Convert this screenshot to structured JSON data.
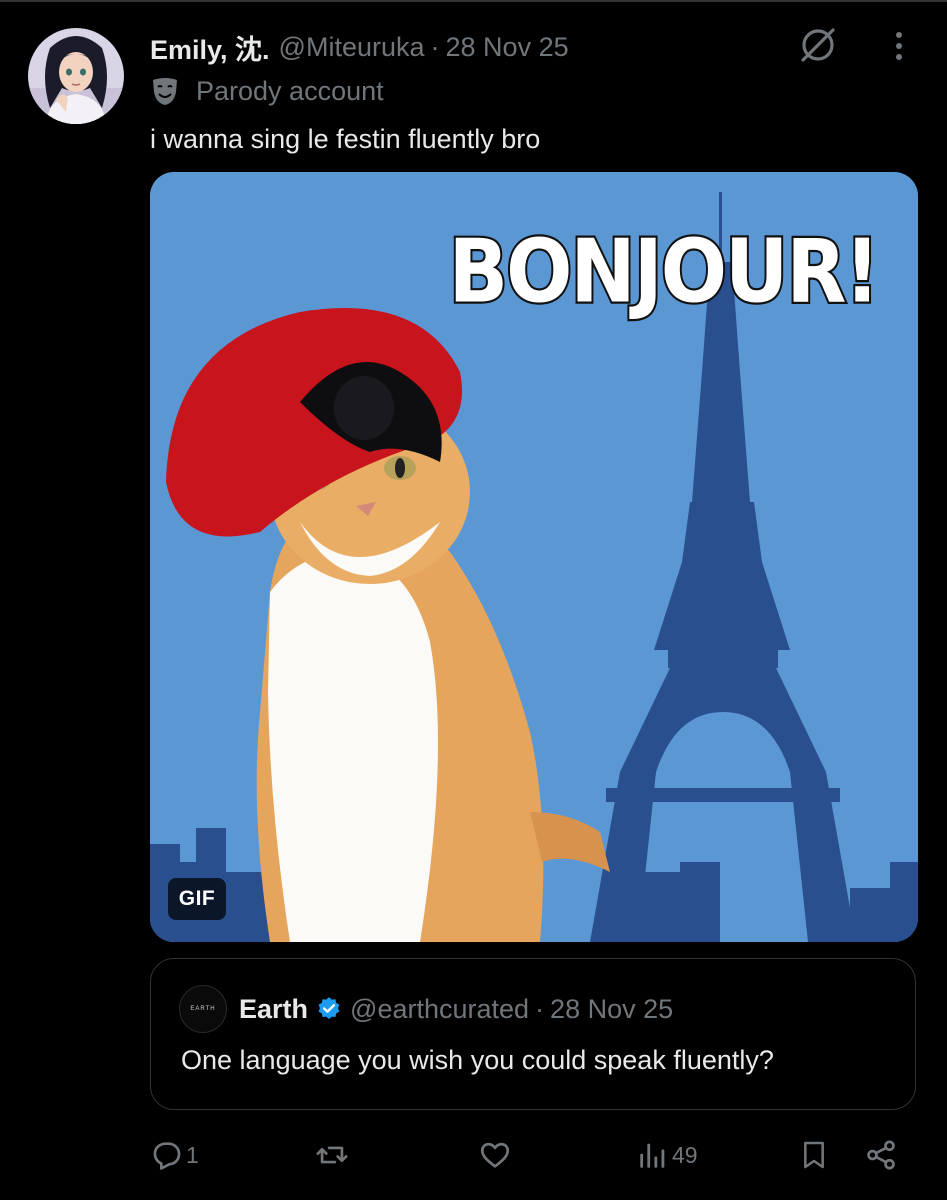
{
  "author": {
    "display_name": "Emily, 沈.",
    "handle": "@Miteuruka",
    "separator": "·",
    "date": "28 Nov 25",
    "label": "Parody account"
  },
  "tweet": {
    "text": "i wanna sing le festin fluently bro"
  },
  "media": {
    "overlay_text": "BONJOUR!",
    "badge": "GIF"
  },
  "quote": {
    "avatar_text": "EARTH",
    "display_name": "Earth",
    "handle": "@earthcurated",
    "separator": "·",
    "date": "28 Nov 25",
    "text": "One language you wish you could speak fluently?"
  },
  "actions": {
    "reply_count": "1",
    "retweet_count": "",
    "like_count": "",
    "views_count": "49"
  },
  "colors": {
    "background": "#000000",
    "text_primary": "#e7e9ea",
    "text_secondary": "#71767b",
    "border": "#2f3336",
    "verified": "#1d9bf0",
    "media_sky": "#5b97d3",
    "tower": "#2a4f8f"
  },
  "icons": [
    "avatar",
    "grok-icon",
    "more-icon",
    "parody-mask-icon",
    "verified-badge-icon",
    "reply-icon",
    "retweet-icon",
    "like-icon",
    "views-icon",
    "bookmark-icon",
    "share-icon"
  ]
}
